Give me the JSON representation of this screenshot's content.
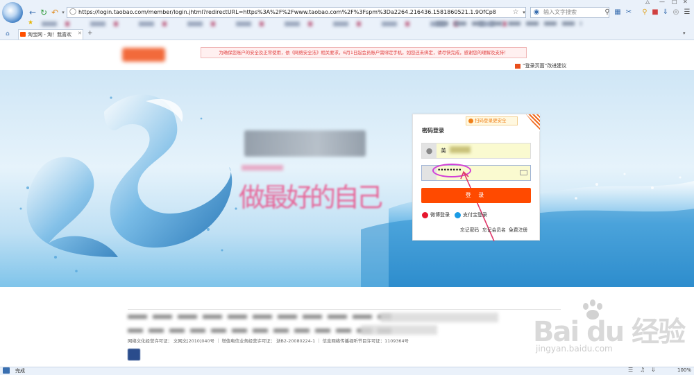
{
  "browser": {
    "address_url": "https://login.taobao.com/member/login.jhtml?redirectURL=https%3A%2F%2Fwww.taobao.com%2F%3Fspm%3Da2264.216436.1581860521.1.9OfCp8",
    "search_placeholder": "输入文字搜索",
    "tab_title": "淘宝网 - 淘！我喜欢",
    "new_tab": "+",
    "status_text": "完成",
    "zoom_level": "100%"
  },
  "header": {
    "notice": "为确保您账户的安全及正常使用，依《网络安全法》相关要求，6月1日起会员账户需绑定手机。如您还未绑定，请尽快完成，感谢您的理解及支持！",
    "feedback": "“登录页面”改进建议"
  },
  "banner": {
    "slogan_pink": "做最好的自己"
  },
  "login": {
    "title": "密码登录",
    "qr_badge": "扫码登录更安全",
    "username_value": "美",
    "password_value": "••••••••",
    "login_button": "登 录",
    "weibo_login": "微博登录",
    "alipay_login": "支付宝登录",
    "forgot_password": "忘记密码",
    "forgot_member": "忘记会员名",
    "register": "免费注册"
  },
  "footer": {
    "license": "网络文化经营许可证： 文网文[2010]040号 ｜ 增值电信业务经营许可证： 浙B2-20080224-1 ｜ 信息网络传播视听节目许可证：1109364号"
  },
  "watermark": {
    "main": "Bai du 经验",
    "sub": "jingyan.baidu.com"
  },
  "colors": {
    "accent_orange": "#ff4a00",
    "annotation_magenta": "#d23fd6",
    "browser_chrome": "#eaf1fa"
  }
}
